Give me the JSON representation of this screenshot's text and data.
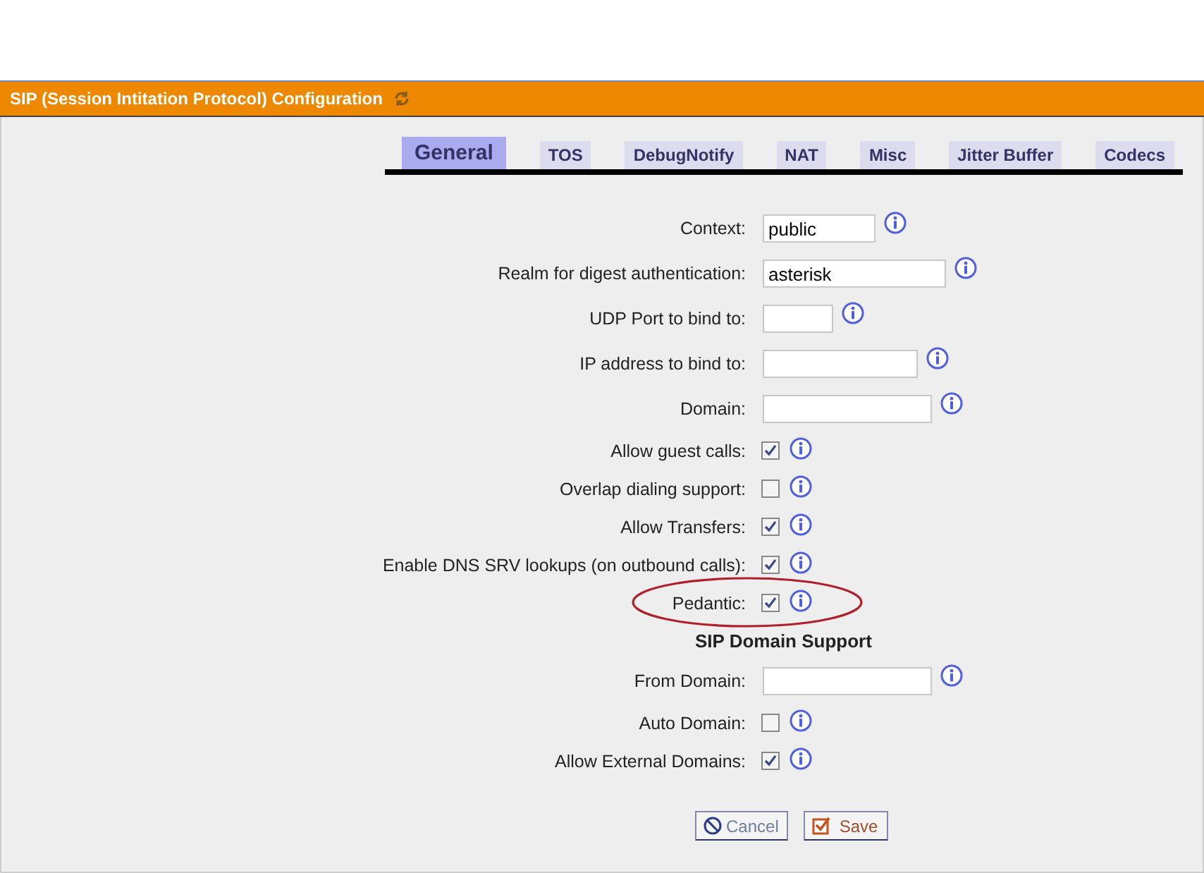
{
  "panel": {
    "title": "SIP (Session Intitation Protocol) Configuration"
  },
  "tabs": [
    {
      "label": "General",
      "selected": true
    },
    {
      "label": "TOS",
      "selected": false
    },
    {
      "label": "DebugNotify",
      "selected": false
    },
    {
      "label": "NAT",
      "selected": false
    },
    {
      "label": "Misc",
      "selected": false
    },
    {
      "label": "Jitter Buffer",
      "selected": false
    },
    {
      "label": "Codecs",
      "selected": false
    }
  ],
  "fields": [
    {
      "kind": "text",
      "label": "Context:",
      "value": "public"
    },
    {
      "kind": "text",
      "label": "Realm for digest authentication:",
      "value": "asterisk"
    },
    {
      "kind": "text",
      "label": "UDP Port to bind to:"
    },
    {
      "kind": "text",
      "label": "IP address to bind to:"
    },
    {
      "kind": "text",
      "label": "Domain:"
    },
    {
      "kind": "checkbox",
      "label": "Allow guest calls:",
      "checked": true
    },
    {
      "kind": "checkbox",
      "label": "Overlap dialing support:",
      "checked": false
    },
    {
      "kind": "checkbox",
      "label": "Allow Transfers:",
      "checked": true
    },
    {
      "kind": "checkbox",
      "label": "Enable DNS SRV lookups (on outbound calls):",
      "checked": true
    },
    {
      "kind": "checkbox",
      "label": "Pedantic:",
      "checked": true,
      "circled": true
    },
    {
      "kind": "heading",
      "label": "SIP Domain Support"
    },
    {
      "kind": "text",
      "label": "From Domain:"
    },
    {
      "kind": "checkbox",
      "label": "Auto Domain:",
      "checked": false
    },
    {
      "kind": "checkbox",
      "label": "Allow External Domains:",
      "checked": true
    }
  ],
  "buttons": [
    {
      "kind": "cancel",
      "label": "Cancel"
    },
    {
      "kind": "save",
      "label": "Save"
    }
  ]
}
